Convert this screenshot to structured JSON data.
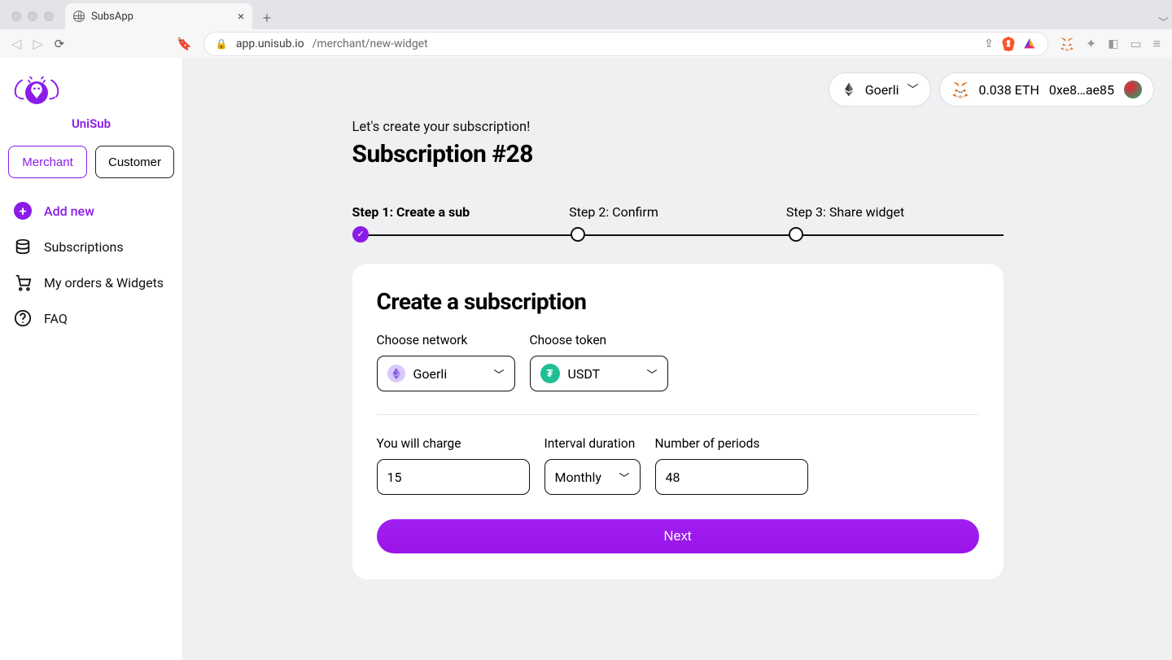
{
  "browser": {
    "tab_title": "SubsApp",
    "url_host": "app.unisub.io",
    "url_path": "/merchant/new-widget"
  },
  "brand": {
    "name": "UniSub"
  },
  "role_toggle": {
    "merchant": "Merchant",
    "customer": "Customer"
  },
  "nav": {
    "add_new": "Add new",
    "subscriptions": "Subscriptions",
    "orders": "My orders & Widgets",
    "faq": "FAQ"
  },
  "header": {
    "network": "Goerli",
    "balance": "0.038 ETH",
    "address": "0xe8…ae85"
  },
  "page": {
    "kicker": "Let's create your subscription!",
    "title": "Subscription #28",
    "steps": {
      "s1": "Step 1: Create a sub",
      "s2": "Step 2: Confirm",
      "s3": "Step 3: Share widget"
    }
  },
  "form": {
    "card_title": "Create a subscription",
    "labels": {
      "network": "Choose network",
      "token": "Choose token",
      "charge": "You will charge",
      "interval": "Interval duration",
      "periods": "Number of periods"
    },
    "values": {
      "network": "Goerli",
      "token": "USDT",
      "charge": "15",
      "interval": "Monthly",
      "periods": "48"
    },
    "next": "Next"
  }
}
